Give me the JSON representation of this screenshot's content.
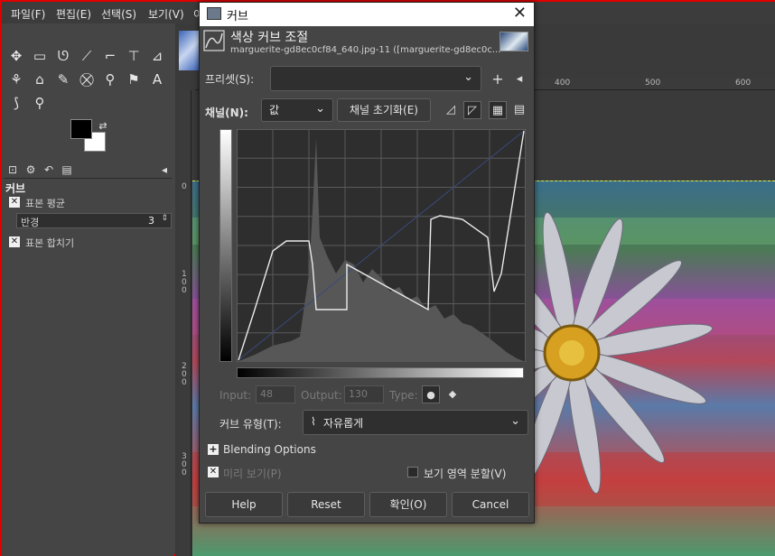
{
  "menubar": {
    "items": [
      "파일(F)",
      "편집(E)",
      "선택(S)",
      "보기(V)",
      "이"
    ]
  },
  "toolbox": {
    "tools": [
      "move-icon",
      "rect-select-icon",
      "lasso-icon",
      "fuzzy-select-icon",
      "crop-icon",
      "transform-icon",
      "perspective-icon",
      "warp-icon",
      "bucket-fill-icon",
      "paintbrush-icon",
      "eraser-icon",
      "clone-icon",
      "smudge-icon",
      "dodge-icon",
      "text-icon",
      "color-picker-icon",
      "zoom-icon"
    ],
    "panel_title": "커브",
    "sample_average_label": "표본 평균",
    "radius_label": "반경",
    "radius_value": "3",
    "sample_merged_label": "표본 합치기"
  },
  "rulers": {
    "h_labels": [
      "400",
      "500",
      "600"
    ],
    "v_labels": [
      "0",
      "1\n0\n0",
      "2\n0\n0",
      "3\n0\n0"
    ]
  },
  "dialog": {
    "window_title": "커브",
    "heading": "색상 커브 조절",
    "subtitle": "marguerite-gd8ec0cf84_640.jpg-11 ([marguerite-gd8ec0c...",
    "presets_label": "프리셋(S):",
    "preset_value": "",
    "channel_label": "채널(N):",
    "channel_value": "값",
    "reset_channel_label": "채널 초기화(E)",
    "input_label": "Input:",
    "input_value": "48",
    "output_label": "Output:",
    "output_value": "130",
    "type_label": "Type:",
    "curve_type_label": "커브 유형(T):",
    "curve_type_value": "자유롭게",
    "blending_label": "Blending Options",
    "preview_label": "미리 보기(P)",
    "split_view_label": "보기 영역 분할(V)",
    "buttons": {
      "help": "Help",
      "reset": "Reset",
      "ok": "확인(O)",
      "cancel": "Cancel"
    }
  },
  "colors": {
    "accent_red": "#e00000",
    "dialog_bg": "#454545",
    "graph_bg": "#2e2e2e"
  }
}
